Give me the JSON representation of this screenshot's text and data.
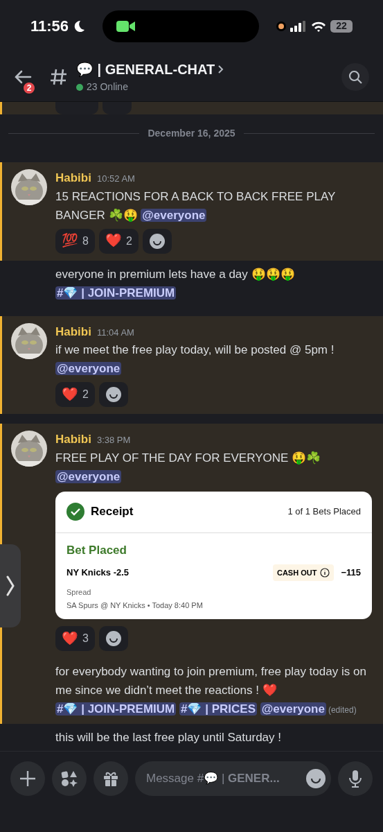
{
  "status_bar": {
    "time": "11:56",
    "battery": "22"
  },
  "header": {
    "back_badge": "2",
    "channel_name": "💬 | GENERAL-CHAT",
    "online": "23 Online"
  },
  "top_partial": {
    "highlighted": true
  },
  "date_divider": "December 16, 2025",
  "messages": [
    {
      "kind": "post",
      "highlighted": true,
      "author": "Habibi",
      "time": "10:52 AM",
      "parts": [
        {
          "kind": "text",
          "text": "15 REACTIONS FOR A BACK TO BACK FREE PLAY BANGER ☘️🤑 "
        },
        {
          "kind": "mention",
          "text": "@everyone"
        }
      ],
      "reactions": [
        {
          "emoji": "💯",
          "count": "8"
        },
        {
          "emoji": "❤️",
          "count": "2"
        }
      ]
    },
    {
      "kind": "followup",
      "highlighted": false,
      "parts": [
        {
          "kind": "text",
          "text": "everyone in premium lets have a day 🤑🤑🤑 "
        },
        {
          "kind": "mention",
          "text": "#💎 | JOIN-PREMIUM"
        }
      ]
    },
    {
      "kind": "post",
      "highlighted": true,
      "author": "Habibi",
      "time": "11:04 AM",
      "parts": [
        {
          "kind": "text",
          "text": "if we meet the free play today, will be posted @ 5pm ! "
        },
        {
          "kind": "mention",
          "text": "@everyone"
        }
      ],
      "reactions": [
        {
          "emoji": "❤️",
          "count": "2"
        }
      ]
    },
    {
      "kind": "post",
      "highlighted": true,
      "author": "Habibi",
      "time": "3:38 PM",
      "parts": [
        {
          "kind": "text",
          "text": "FREE PLAY OF THE DAY FOR EVERYONE 🤑☘️ "
        },
        {
          "kind": "mention",
          "text": "@everyone"
        }
      ],
      "receipt": {
        "title": "Receipt",
        "count": "1 of 1 Bets Placed",
        "status": "Bet Placed",
        "pick": "NY Knicks -2.5",
        "cash_out": "CASH OUT",
        "odds": "−115",
        "market": "Spread",
        "event": "SA Spurs @ NY Knicks • Today 8:40 PM"
      },
      "reactions": [
        {
          "emoji": "❤️",
          "count": "3"
        }
      ]
    },
    {
      "kind": "followup",
      "highlighted": true,
      "parts": [
        {
          "kind": "text",
          "text": "for everybody wanting to join premium, free play today is on me since we didn’t meet the reactions ! ❤️ "
        },
        {
          "kind": "mention",
          "text": "#💎 | JOIN-PREMIUM"
        },
        {
          "kind": "mention",
          "text": "#💎 | PRICES"
        },
        {
          "kind": "mention",
          "text": "@everyone"
        }
      ],
      "edited": "(edited)"
    },
    {
      "kind": "followup",
      "highlighted": false,
      "parts": [
        {
          "kind": "text",
          "text": "this will be the last free play until Saturday !"
        }
      ]
    }
  ],
  "composer": {
    "placeholder": "Message #💬 | **GENER...**"
  }
}
